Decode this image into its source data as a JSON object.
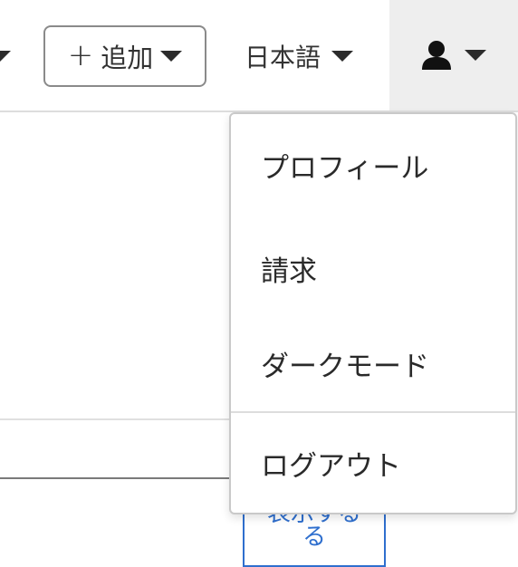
{
  "header": {
    "add_button": {
      "label": "追加"
    },
    "language": {
      "selected": "日本語"
    },
    "user_menu": {
      "icon": "user-icon"
    }
  },
  "user_dropdown": {
    "items": [
      {
        "label": "プロフィール"
      },
      {
        "label": "請求"
      },
      {
        "label": "ダークモード"
      },
      {
        "label": "ログアウト"
      }
    ]
  },
  "background": {
    "action_partial_label": "表示する",
    "action_visible_label": "る"
  },
  "colors": {
    "border": "#8a8a8a",
    "user_menu_bg": "#eeeeee",
    "link": "#2f6fce",
    "text": "#2a2a2a"
  }
}
